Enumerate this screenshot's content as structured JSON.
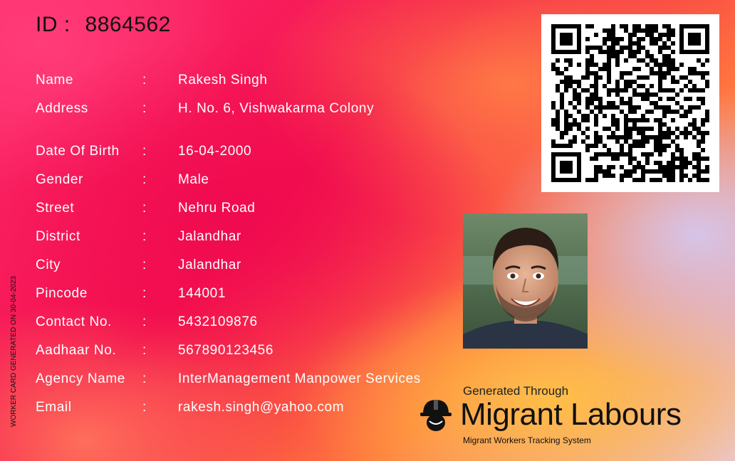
{
  "card": {
    "id_label": "ID :",
    "id_value": "8864562",
    "colon": ":",
    "side_note": "WORKER CARD GENERATED ON 30-04-2023"
  },
  "fields": [
    {
      "label": "Name",
      "value": "Rakesh Singh"
    },
    {
      "label": "Address",
      "value": "H. No. 6, Vishwakarma Colony"
    },
    {
      "label": "Date Of Birth",
      "value": "16-04-2000"
    },
    {
      "label": "Gender",
      "value": "Male"
    },
    {
      "label": "Street",
      "value": "Nehru Road"
    },
    {
      "label": "District",
      "value": "Jalandhar"
    },
    {
      "label": "City",
      "value": "Jalandhar"
    },
    {
      "label": "Pincode",
      "value": "144001"
    },
    {
      "label": "Contact No.",
      "value": "5432109876"
    },
    {
      "label": "Aadhaar No.",
      "value": "567890123456"
    },
    {
      "label": "Agency Name",
      "value": "InterManagement Manpower Services"
    },
    {
      "label": "Email",
      "value": "rakesh.singh@yahoo.com"
    }
  ],
  "branding": {
    "generated_through": "Generated Through",
    "name": "Migrant Labours",
    "tagline": "Migrant Workers Tracking System",
    "logo_icon": "hard-hat-worker-icon"
  },
  "qr": {
    "icon": "qr-code-icon"
  },
  "photo": {
    "icon": "worker-photo"
  },
  "colors": {
    "text_dark": "#111111",
    "text_light": "#ffffff",
    "accent_pink": "#f3104e",
    "accent_orange": "#ff7a3d"
  }
}
